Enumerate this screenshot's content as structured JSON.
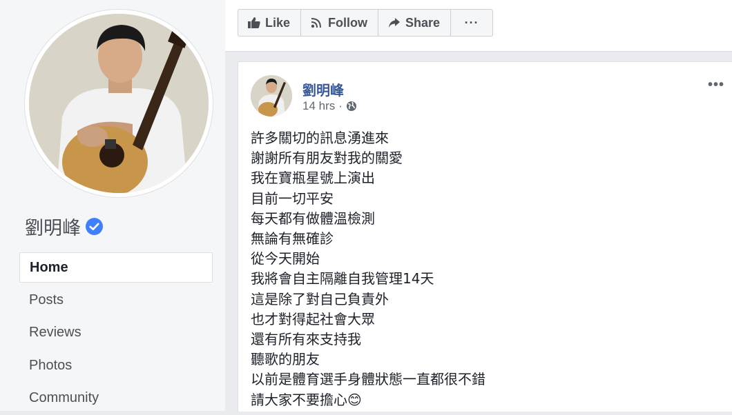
{
  "page": {
    "name": "劉明峰",
    "verified": true
  },
  "nav": {
    "items": [
      {
        "label": "Home",
        "active": true
      },
      {
        "label": "Posts"
      },
      {
        "label": "Reviews"
      },
      {
        "label": "Photos"
      },
      {
        "label": "Community"
      }
    ]
  },
  "actions": {
    "like": "Like",
    "follow": "Follow",
    "share": "Share",
    "more": "···"
  },
  "post": {
    "author": "劉明峰",
    "time": "14 hrs",
    "separator": "·",
    "privacy_icon": "globe-icon",
    "menu": "•••",
    "lines": [
      "許多關切的訊息湧進來",
      "謝謝所有朋友對我的關愛",
      "我在寶瓶星號上演出",
      "目前一切平安",
      "每天都有做體溫檢測",
      "無論有無確診",
      "從今天開始",
      "我將會自主隔離自我管理14天",
      "這是除了對自己負責外",
      "也才對得起社會大眾",
      "還有所有來支持我",
      "聽歌的朋友",
      "以前是體育選手身體狀態一直都很不錯",
      "請大家不要擔心😊"
    ]
  },
  "colors": {
    "link": "#385898",
    "verified": "#4080ff",
    "border": "#dddfe2"
  }
}
